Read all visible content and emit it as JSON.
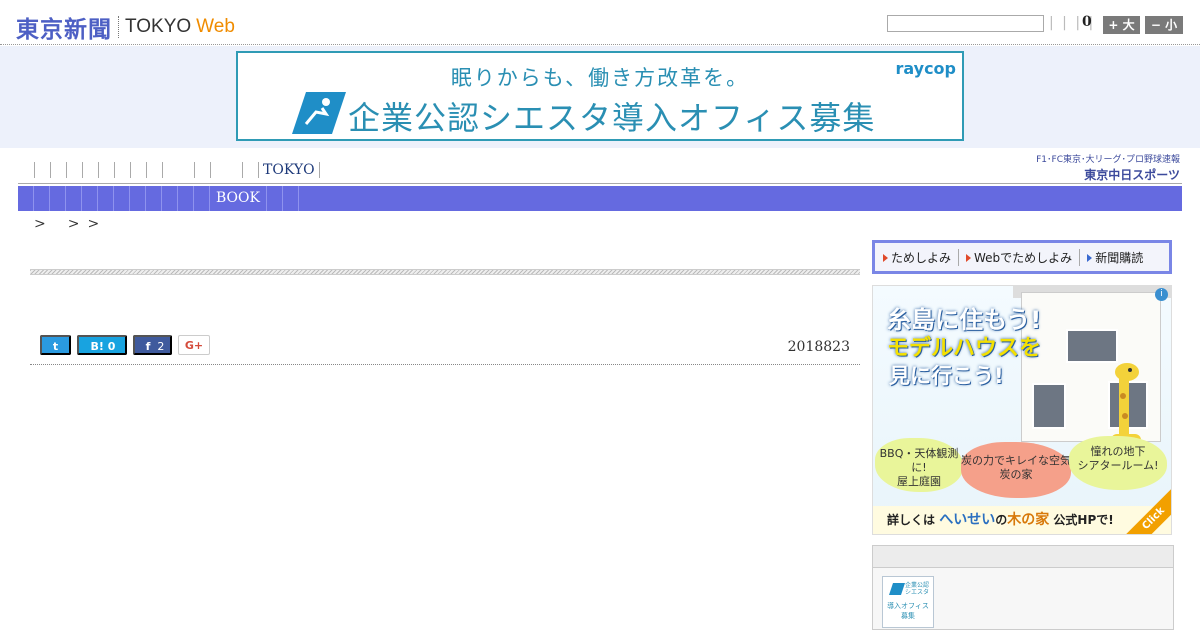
{
  "header": {
    "logo_jp": "東京新聞",
    "logo_en": "TOKYO",
    "logo_web": "Web",
    "separator": "| | | |",
    "font_size_count": "0",
    "size_large_label": "+ 大",
    "size_small_label": "− 小"
  },
  "top_banner": {
    "line1": "眠りからも、働き方改革を。",
    "line2": "企業公認シエスタ導入オフィス募集",
    "brand": "raycop"
  },
  "nav1": {
    "label": "TOKYO",
    "chunichi_top": "F1･FC東京･大リーグ･プロ野球速報",
    "chunichi_bottom": "東京中日スポーツ"
  },
  "nav2": {
    "label": "BOOK"
  },
  "breadcrumb": {
    "sep1": ">",
    "sep2": ">",
    "sep3": ">"
  },
  "article": {
    "share": {
      "twitter_label": "t",
      "hatena_label": "B! 0",
      "facebook_label": "f",
      "facebook_count": "2",
      "gplus_label": "G+"
    },
    "pub_date": "2018823"
  },
  "sidebar": {
    "subscribe": {
      "item1": "ためしよみ",
      "item2": "Webでためしよみ",
      "item3": "新聞購読"
    },
    "ad": {
      "info_icon": "i",
      "head1": "糸島に住もう!",
      "head2": "モデルハウスを",
      "head3": "見に行こう!",
      "bubble1": "BBQ・天体観測に!\n屋上庭園",
      "bubble2": "炭の力でキレイな空気\n炭の家",
      "bubble3": "憧れの地下\nシアタールーム!",
      "footer_prefix": "詳しくは",
      "footer_brand": "へいせい",
      "footer_mid": "の",
      "footer_ki": "木の家",
      "footer_suffix": "公式HPで!",
      "click": "Click"
    },
    "thumb": {
      "text1": "企業公認\nシエスタ",
      "text2": "導入オフィス\n募集"
    }
  },
  "colors": {
    "brand_blue": "#4d5fc4",
    "web_orange": "#f08c00",
    "nav_blue": "#656ae0",
    "banner_teal": "#2a8fb3"
  }
}
